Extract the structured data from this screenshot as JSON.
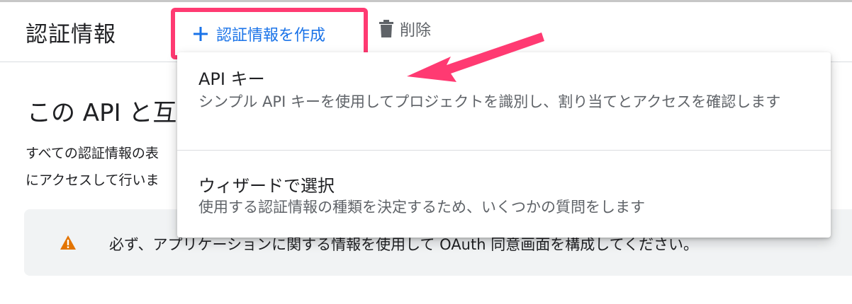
{
  "header": {
    "title": "認証情報",
    "create_label": "認証情報を作成",
    "delete_label": "削除"
  },
  "section": {
    "title": "この API と互",
    "desc_line1": "すべての認証情報の表",
    "desc_line2": "にアクセスして行いま"
  },
  "notice": {
    "text": "必ず、アプリケーションに関する情報を使用して OAuth 同意画面を構成してください。"
  },
  "menu": {
    "items": [
      {
        "title": "API キー",
        "description": "シンプル API キーを使用してプロジェクトを識別し、割り当てとアクセスを確認します"
      },
      {
        "title": "ウィザードで選択",
        "description": "使用する認証情報の種類を決定するため、いくつかの質問をします"
      }
    ]
  },
  "colors": {
    "accent": "#1a73e8",
    "highlight": "#ff3a72",
    "warning": "#e37400"
  },
  "icons": [
    "plus-icon",
    "trash-icon",
    "warning-icon",
    "pointer-arrow"
  ]
}
